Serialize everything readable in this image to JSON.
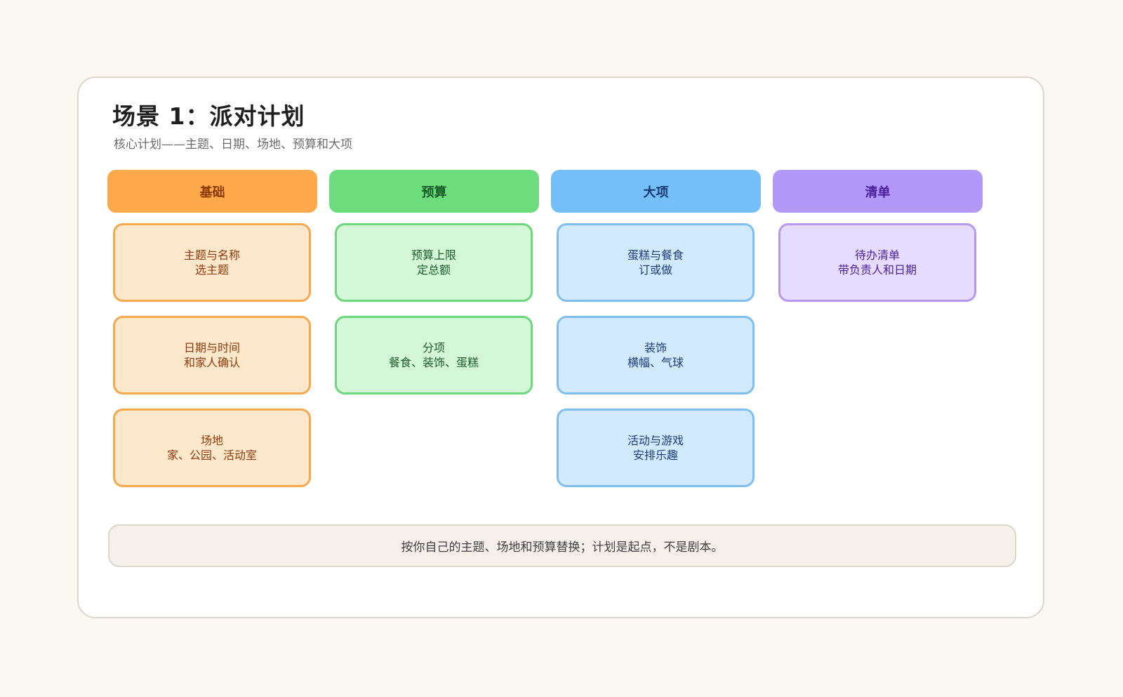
{
  "page": {
    "title": "场景 1：派对计划",
    "subtitle": "核心计划——主题、日期、场地、预算和大项",
    "note": "按你自己的主题、场地和预算替换；计划是起点，不是剧本。"
  },
  "columns": [
    {
      "label": "基础",
      "color": "#fea94b",
      "items": [
        {
          "line1": "主题与名称",
          "line2": "选主题"
        },
        {
          "line1": "日期与时间",
          "line2": "和家人确认"
        },
        {
          "line1": "场地",
          "line2": "家、公园、活动室"
        }
      ]
    },
    {
      "label": "预算",
      "color": "#6cdc7c",
      "items": [
        {
          "line1": "预算上限",
          "line2": "定总额"
        },
        {
          "line1": "分项",
          "line2": "餐食、装饰、蛋糕"
        }
      ]
    },
    {
      "label": "大项",
      "color": "#74bff9",
      "items": [
        {
          "line1": "蛋糕与餐食",
          "line2": "订或做"
        },
        {
          "line1": "装饰",
          "line2": "横幅、气球"
        },
        {
          "line1": "活动与游戏",
          "line2": "安排乐趣"
        }
      ]
    },
    {
      "label": "清单",
      "color": "#b298f8",
      "items": [
        {
          "line1": "待办清单",
          "line2": "带负责人和日期"
        }
      ]
    }
  ]
}
